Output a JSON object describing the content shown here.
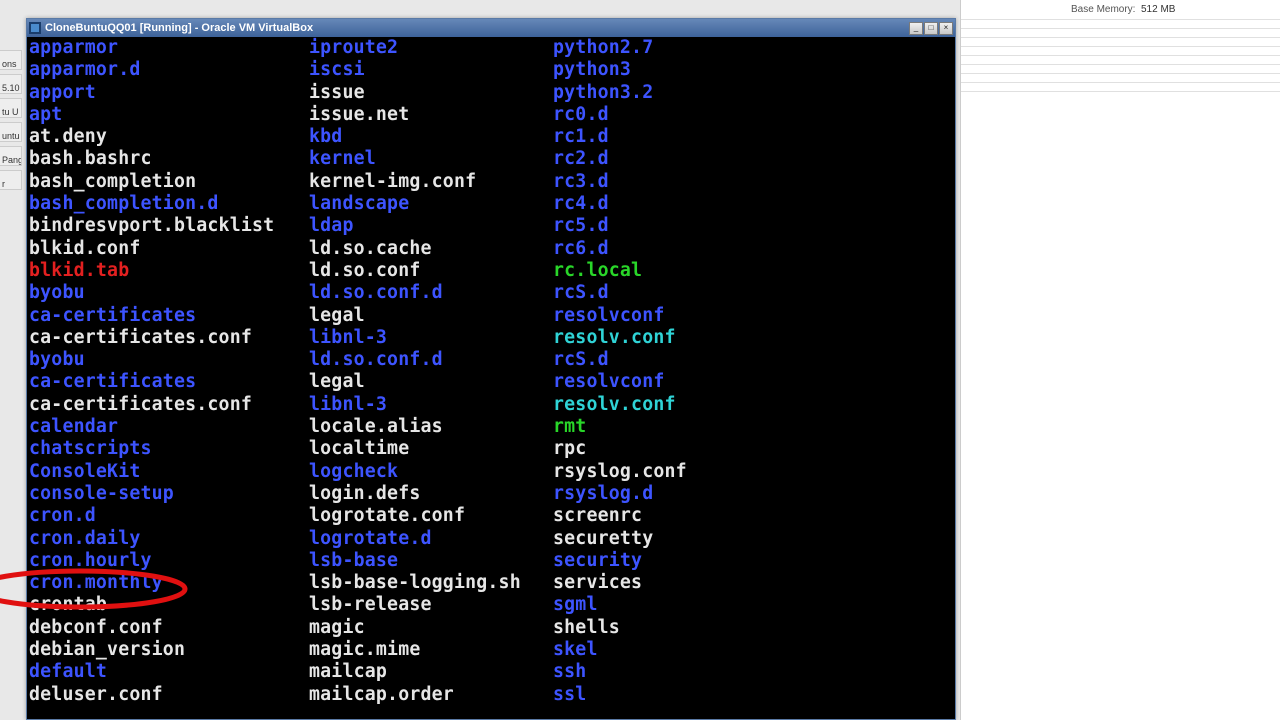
{
  "background": {
    "memory_label": "Base Memory:",
    "memory_value": "512 MB",
    "left_tabs": [
      "ons",
      "5.10",
      "tu U",
      "untu U",
      "Pango",
      "r"
    ]
  },
  "window": {
    "title": "CloneBuntuQQ01 [Running] - Oracle VM VirtualBox",
    "min_tooltip": "_",
    "max_tooltip": "□",
    "close_tooltip": "×"
  },
  "listing": [
    {
      "c0": [
        "apparmor",
        "blue"
      ],
      "c1": [
        "iproute2",
        "blue"
      ],
      "c2": [
        "python2.7",
        "blue"
      ]
    },
    {
      "c0": [
        "apparmor.d",
        "blue"
      ],
      "c1": [
        "iscsi",
        "blue"
      ],
      "c2": [
        "python3",
        "blue"
      ]
    },
    {
      "c0": [
        "apport",
        "blue"
      ],
      "c1": [
        "issue",
        "white"
      ],
      "c2": [
        "python3.2",
        "blue"
      ]
    },
    {
      "c0": [
        "apt",
        "blue"
      ],
      "c1": [
        "issue.net",
        "white"
      ],
      "c2": [
        "rc0.d",
        "blue"
      ]
    },
    {
      "c0": [
        "at.deny",
        "white"
      ],
      "c1": [
        "kbd",
        "blue"
      ],
      "c2": [
        "rc1.d",
        "blue"
      ]
    },
    {
      "c0": [
        "bash.bashrc",
        "white"
      ],
      "c1": [
        "kernel",
        "blue"
      ],
      "c2": [
        "rc2.d",
        "blue"
      ]
    },
    {
      "c0": [
        "bash_completion",
        "white"
      ],
      "c1": [
        "kernel-img.conf",
        "white"
      ],
      "c2": [
        "rc3.d",
        "blue"
      ]
    },
    {
      "c0": [
        "bash_completion.d",
        "blue"
      ],
      "c1": [
        "landscape",
        "blue"
      ],
      "c2": [
        "rc4.d",
        "blue"
      ]
    },
    {
      "c0": [
        "bindresvport.blacklist",
        "white"
      ],
      "c1": [
        "ldap",
        "blue"
      ],
      "c2": [
        "rc5.d",
        "blue"
      ]
    },
    {
      "c0": [
        "blkid.conf",
        "white"
      ],
      "c1": [
        "ld.so.cache",
        "white"
      ],
      "c2": [
        "rc6.d",
        "blue"
      ]
    },
    {
      "c0": [
        "blkid.tab",
        "red"
      ],
      "c1": [
        "ld.so.conf",
        "white"
      ],
      "c2": [
        "rc.local",
        "green"
      ]
    },
    {
      "c0": [
        "byobu",
        "blue"
      ],
      "c1": [
        "ld.so.conf.d",
        "blue"
      ],
      "c2": [
        "rcS.d",
        "blue"
      ]
    },
    {
      "c0": [
        "ca-certificates",
        "blue"
      ],
      "c1": [
        "legal",
        "white"
      ],
      "c2": [
        "resolvconf",
        "blue"
      ]
    },
    {
      "c0": [
        "ca-certificates.conf",
        "white"
      ],
      "c1": [
        "libnl-3",
        "blue"
      ],
      "c2": [
        "resolv.conf",
        "cyan"
      ]
    },
    {
      "c0": [
        "byobu",
        "blue"
      ],
      "c1": [
        "ld.so.conf.d",
        "blue"
      ],
      "c2": [
        "rcS.d",
        "blue"
      ]
    },
    {
      "c0": [
        "ca-certificates",
        "blue"
      ],
      "c1": [
        "legal",
        "white"
      ],
      "c2": [
        "resolvconf",
        "blue"
      ]
    },
    {
      "c0": [
        "ca-certificates.conf",
        "white"
      ],
      "c1": [
        "libnl-3",
        "blue"
      ],
      "c2": [
        "resolv.conf",
        "cyan"
      ]
    },
    {
      "c0": [
        "calendar",
        "blue"
      ],
      "c1": [
        "locale.alias",
        "white"
      ],
      "c2": [
        "rmt",
        "green"
      ]
    },
    {
      "c0": [
        "chatscripts",
        "blue"
      ],
      "c1": [
        "localtime",
        "white"
      ],
      "c2": [
        "rpc",
        "white"
      ]
    },
    {
      "c0": [
        "ConsoleKit",
        "blue"
      ],
      "c1": [
        "logcheck",
        "blue"
      ],
      "c2": [
        "rsyslog.conf",
        "white"
      ]
    },
    {
      "c0": [
        "console-setup",
        "blue"
      ],
      "c1": [
        "login.defs",
        "white"
      ],
      "c2": [
        "rsyslog.d",
        "blue"
      ]
    },
    {
      "c0": [
        "cron.d",
        "blue"
      ],
      "c1": [
        "logrotate.conf",
        "white"
      ],
      "c2": [
        "screenrc",
        "white"
      ]
    },
    {
      "c0": [
        "cron.daily",
        "blue"
      ],
      "c1": [
        "logrotate.d",
        "blue"
      ],
      "c2": [
        "securetty",
        "white"
      ]
    },
    {
      "c0": [
        "cron.hourly",
        "blue"
      ],
      "c1": [
        "lsb-base",
        "blue"
      ],
      "c2": [
        "security",
        "blue"
      ]
    },
    {
      "c0": [
        "cron.monthly",
        "blue"
      ],
      "c1": [
        "lsb-base-logging.sh",
        "white"
      ],
      "c2": [
        "services",
        "white"
      ]
    },
    {
      "c0": [
        "crontab",
        "white"
      ],
      "c1": [
        "lsb-release",
        "white"
      ],
      "c2": [
        "sgml",
        "blue"
      ]
    },
    {
      "c0": [
        "debconf.conf",
        "white"
      ],
      "c1": [
        "magic",
        "white"
      ],
      "c2": [
        "shells",
        "white"
      ]
    },
    {
      "c0": [
        "debian_version",
        "white"
      ],
      "c1": [
        "magic.mime",
        "white"
      ],
      "c2": [
        "skel",
        "blue"
      ]
    },
    {
      "c0": [
        "default",
        "blue"
      ],
      "c1": [
        "mailcap",
        "white"
      ],
      "c2": [
        "ssh",
        "blue"
      ]
    },
    {
      "c0": [
        "deluser.conf",
        "white"
      ],
      "c1": [
        "mailcap.order",
        "white"
      ],
      "c2": [
        "ssl",
        "blue"
      ]
    }
  ]
}
